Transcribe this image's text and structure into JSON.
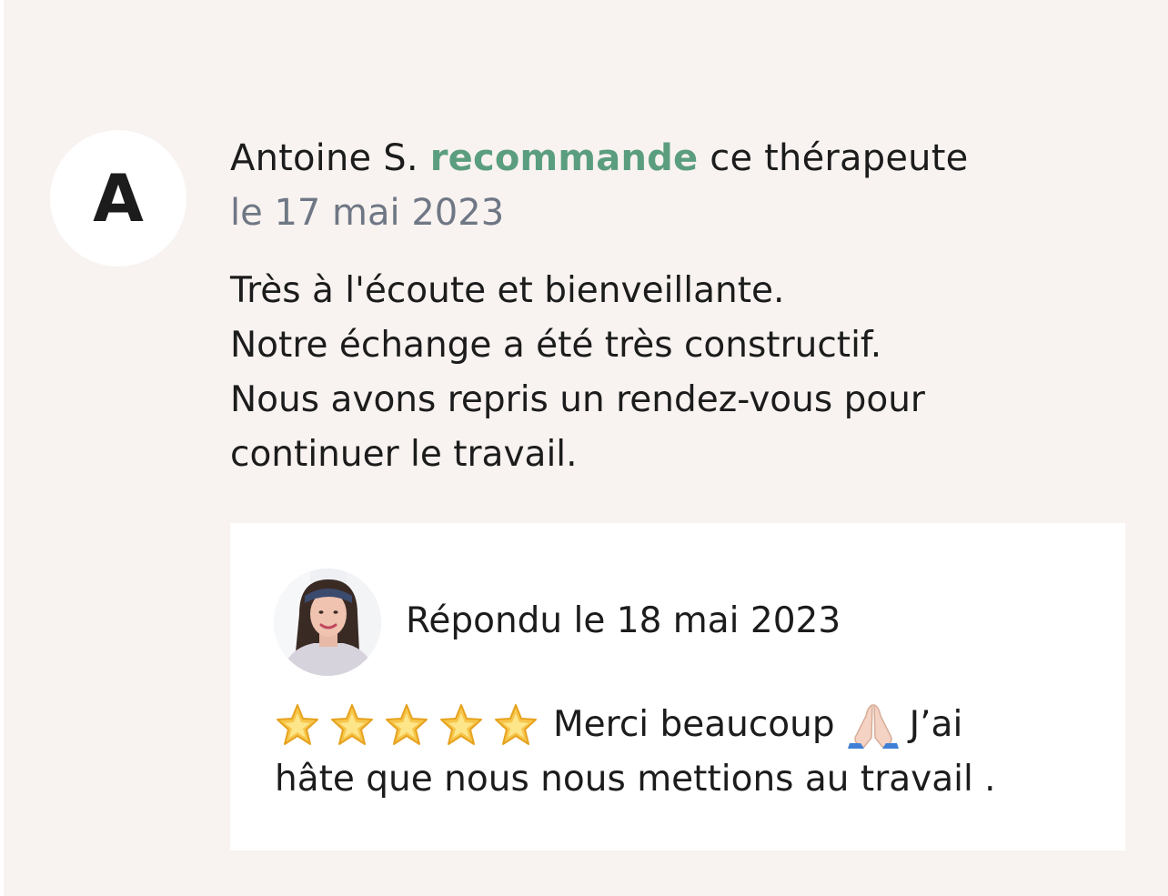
{
  "review": {
    "avatar_letter": "A",
    "author": "Antoine S.",
    "verb": "recommande",
    "suffix": "ce thérapeute",
    "date": "le 17 mai 2023",
    "body_lines": [
      "Très à l'écoute et bienveillante.",
      "Notre échange a été très constructif.",
      "Nous avons repris un rendez-vous pour",
      "continuer le travail."
    ]
  },
  "reply": {
    "avatar_icon": "therapist-photo",
    "date": "Répondu le 18 mai 2023",
    "star_icon": "glowing-star-icon",
    "star_count": 5,
    "text_part1": "Merci beaucoup",
    "pray_icon": "folded-hands-icon",
    "text_part2": "J’ai",
    "text_line2": "hâte que nous nous mettions au travail ."
  },
  "colors": {
    "background": "#f8f3f0",
    "accent_green": "#5b9e7f",
    "date_gray": "#6f7785",
    "text": "#1c1c1c"
  }
}
